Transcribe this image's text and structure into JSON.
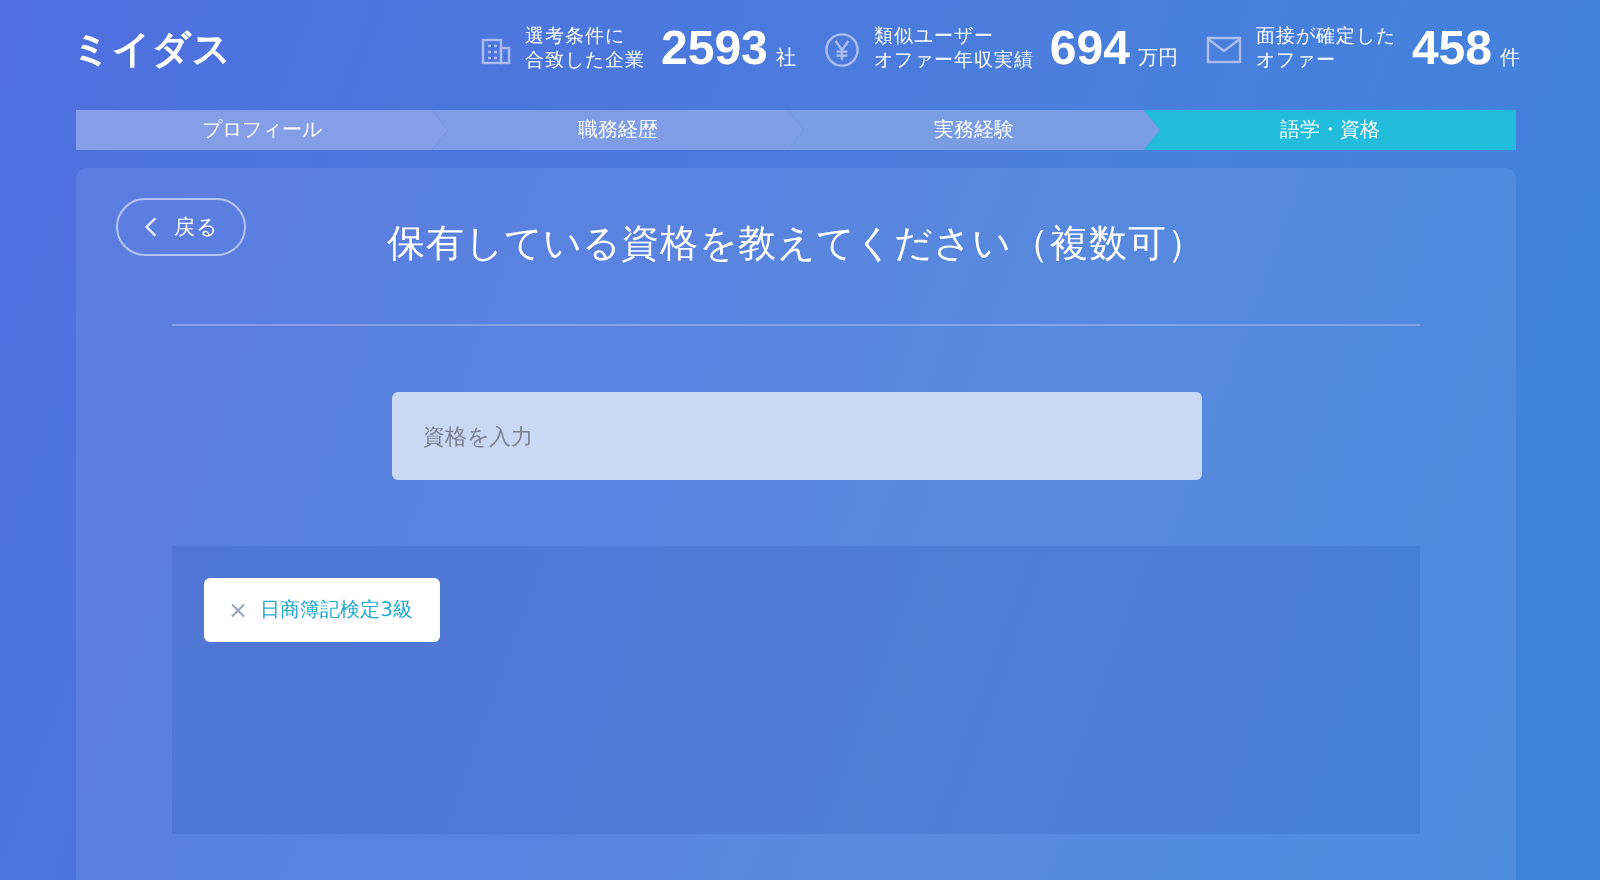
{
  "header": {
    "logo": "ミイダス",
    "stats": [
      {
        "kind": "building",
        "label_lines": [
          "選考条件に",
          "合致した企業"
        ],
        "value": "2593",
        "unit": "社"
      },
      {
        "kind": "yen",
        "label_lines": [
          "類似ユーザー",
          "オファー年収実績"
        ],
        "value": "694",
        "unit": "万円"
      },
      {
        "kind": "mail",
        "label_lines": [
          "面接が確定した",
          "オファー"
        ],
        "value": "458",
        "unit": "件"
      }
    ]
  },
  "steps": [
    {
      "label": "プロフィール",
      "selected": false
    },
    {
      "label": "職務経歴",
      "selected": false
    },
    {
      "label": "実務経験",
      "selected": false
    },
    {
      "label": "語学・資格",
      "selected": true
    }
  ],
  "card": {
    "back_button": "戻る",
    "title": "保有している資格を教えてください（複数可）",
    "input": {
      "placeholder": "資格を入力"
    },
    "tags": [
      {
        "label": "日商簿記検定3級",
        "remove": "×"
      }
    ]
  }
}
